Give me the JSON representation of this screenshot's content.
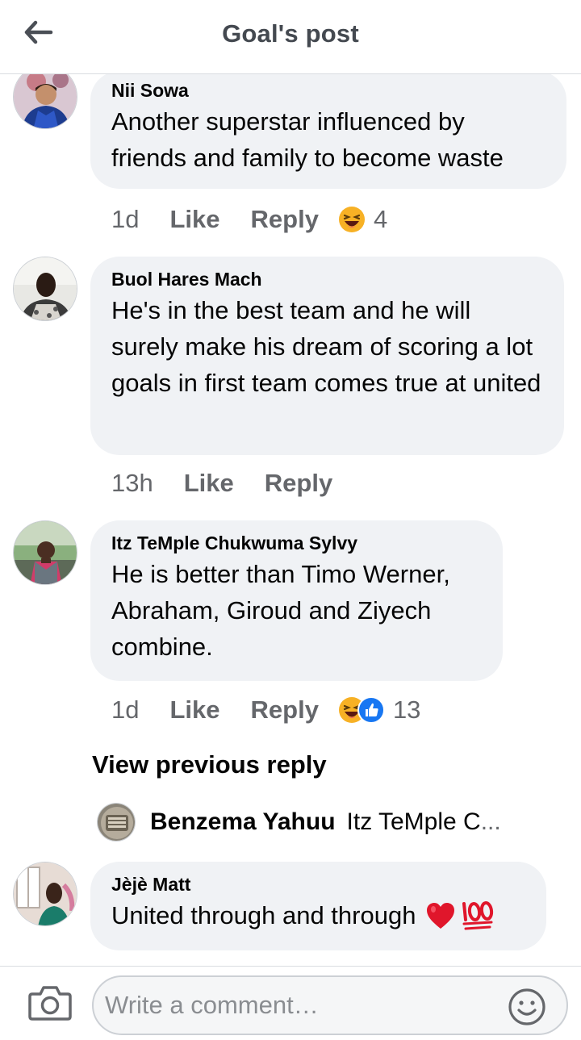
{
  "header": {
    "title": "Goal's post"
  },
  "comments": [
    {
      "author": "Nii Sowa",
      "text": "Another superstar influenced by friends and family to become waste",
      "time": "1d",
      "like_label": "Like",
      "reply_label": "Reply",
      "reactions": [
        "haha"
      ],
      "reaction_count": "4"
    },
    {
      "author": "Buol Hares Mach",
      "text": "He's in the  best team and he will surely make his dream of scoring a lot goals in first team comes true at united",
      "time": "13h",
      "like_label": "Like",
      "reply_label": "Reply",
      "reactions": [],
      "reaction_count": ""
    },
    {
      "author": "Itz TeMple Chukwuma Sylvy",
      "text": "He is better than Timo Werner, Abraham, Giroud and Ziyech combine.",
      "time": "1d",
      "like_label": "Like",
      "reply_label": "Reply",
      "reactions": [
        "haha",
        "like"
      ],
      "reaction_count": "13"
    },
    {
      "author": "Jèjè Matt",
      "text": "United through and through",
      "emoji_suffix": [
        "red-heart",
        "hundred-points"
      ]
    }
  ],
  "view_previous": "View previous reply",
  "reply_preview": {
    "author": "Benzema Yahuu",
    "snippet": "Itz TeMple C",
    "ellipsis": "..."
  },
  "composer": {
    "placeholder": "Write a comment…"
  },
  "colors": {
    "bubble": "#f0f2f5",
    "meta_text": "#65676b",
    "like_blue": "#1877f2",
    "haha_yellow": "#f7b125",
    "heart_red": "#e0162b"
  }
}
